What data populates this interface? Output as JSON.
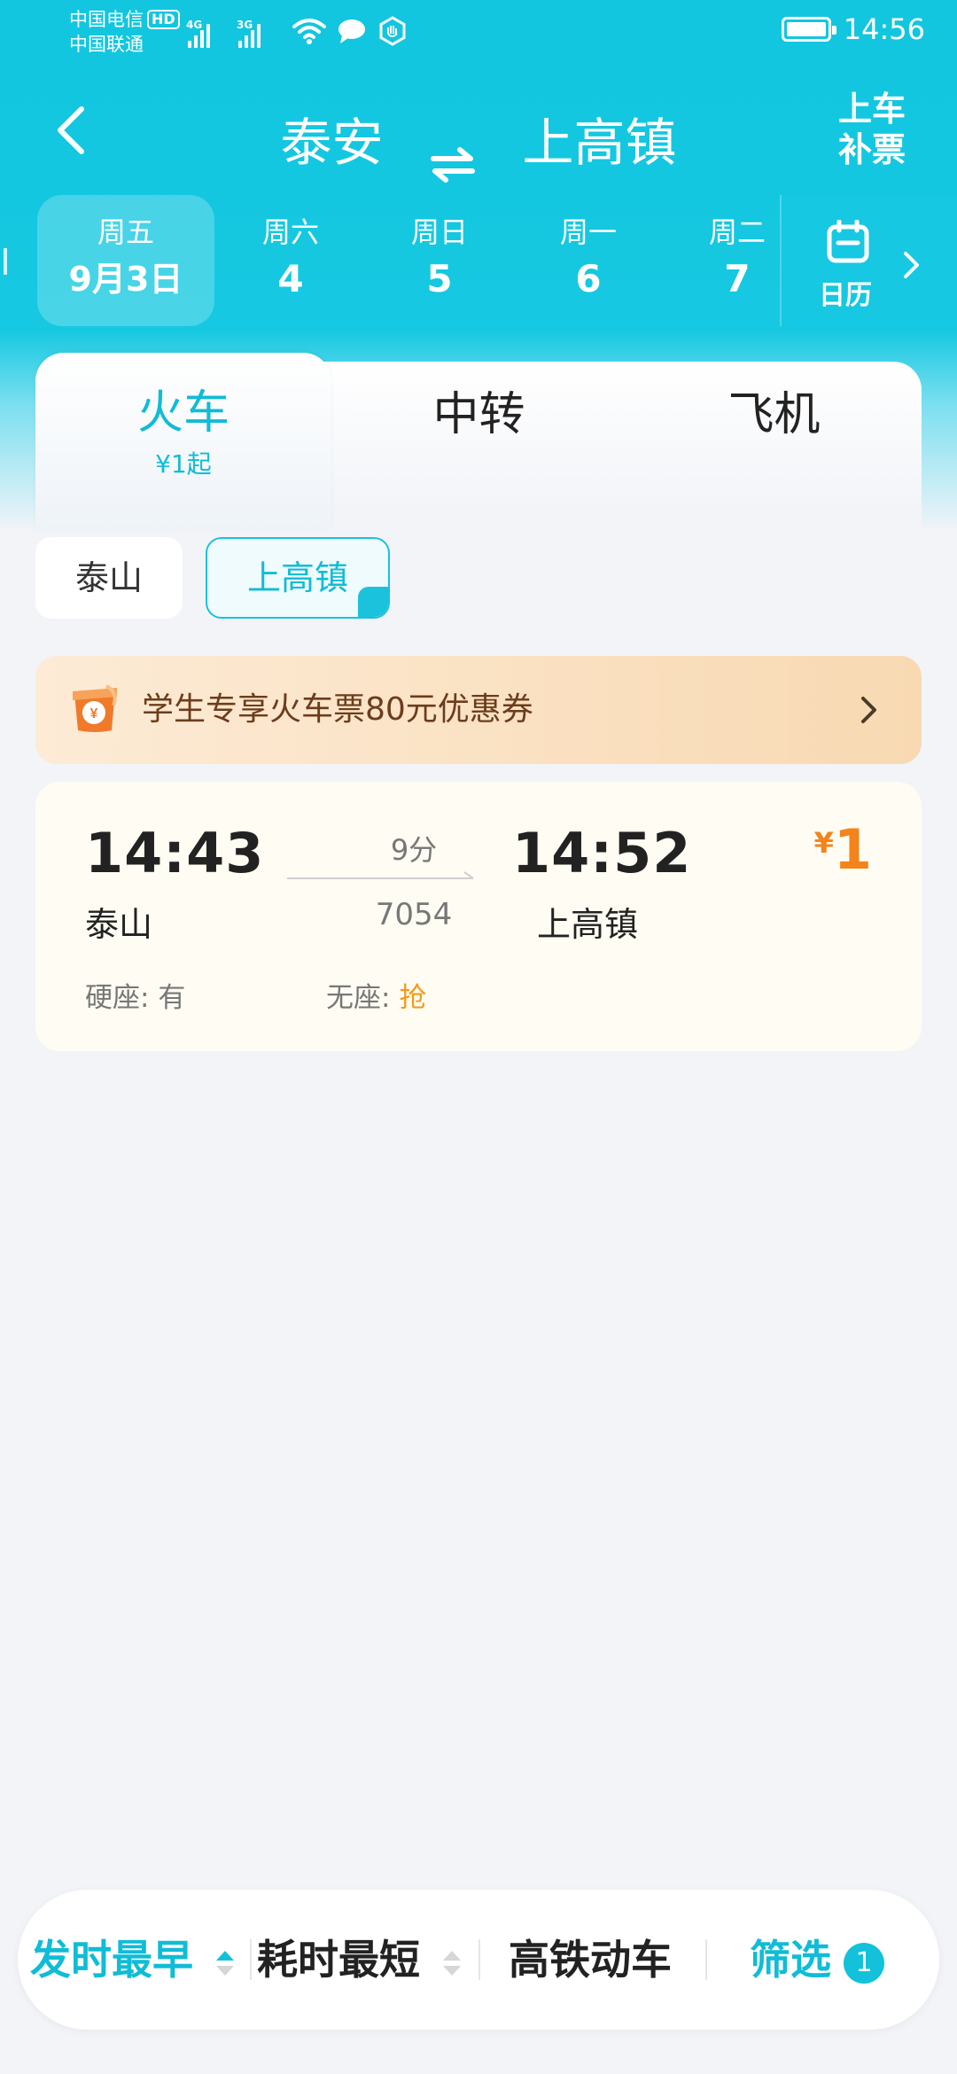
{
  "status_bar": {
    "carrier1": "中国电信",
    "carrier1_badge": "HD",
    "carrier2": "中国联通",
    "net1": "4G",
    "net2": "3G",
    "time": "14:56"
  },
  "nav": {
    "from": "泰安",
    "to": "上高镇",
    "board_ticket_line1": "上车",
    "board_ticket_line2": "补票"
  },
  "dates": [
    {
      "dow": "周五",
      "day": "9月3日",
      "active": true
    },
    {
      "dow": "周六",
      "day": "4"
    },
    {
      "dow": "周日",
      "day": "5"
    },
    {
      "dow": "周一",
      "day": "6"
    },
    {
      "dow": "周二",
      "day": "7"
    }
  ],
  "calendar_label": "日历",
  "modes": [
    {
      "name": "火车",
      "sub": "¥1起",
      "active": true
    },
    {
      "name": "中转"
    },
    {
      "name": "飞机"
    }
  ],
  "stations": [
    {
      "name": "泰山",
      "selected": false
    },
    {
      "name": "上高镇",
      "selected": true
    }
  ],
  "coupon": {
    "text": "学生专享火车票80元优惠券"
  },
  "trains": [
    {
      "depart_time": "14:43",
      "depart_station": "泰山",
      "duration": "9分",
      "train_no": "7054",
      "arrive_time": "14:52",
      "arrive_station": "上高镇",
      "price_currency": "¥",
      "price": "1",
      "seat1_label": "硬座:",
      "seat1_value": "有",
      "seat2_label": "无座:",
      "seat2_value": "抢"
    }
  ],
  "bottom_bar": {
    "sort_earliest": "发时最早",
    "sort_shortest": "耗时最短",
    "high_speed": "高铁动车",
    "filter": "筛选",
    "filter_count": "1"
  },
  "colors": {
    "brand": "#12c6df",
    "accent_text": "#10bcd6",
    "price": "#f3841c",
    "coupon_text": "#6b3d1b"
  }
}
